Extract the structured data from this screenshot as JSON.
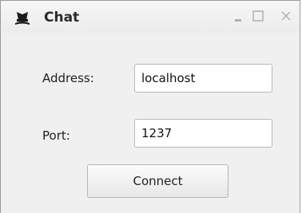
{
  "window": {
    "title": "Chat",
    "app_icon": "magician-hat-icon",
    "controls": {
      "minimize_icon": "minimize-icon",
      "maximize_icon": "maximize-icon",
      "close_icon": "close-icon"
    }
  },
  "form": {
    "address_label": "Address:",
    "address_value": "localhost",
    "port_label": "Port:",
    "port_value": "1237",
    "connect_label": "Connect"
  },
  "colors": {
    "window_bg": "#f0f0f0",
    "titlebar_bg": "#f0f0f0",
    "title_text": "#2a2a2a",
    "control_glyph": "#b0b0b0"
  }
}
